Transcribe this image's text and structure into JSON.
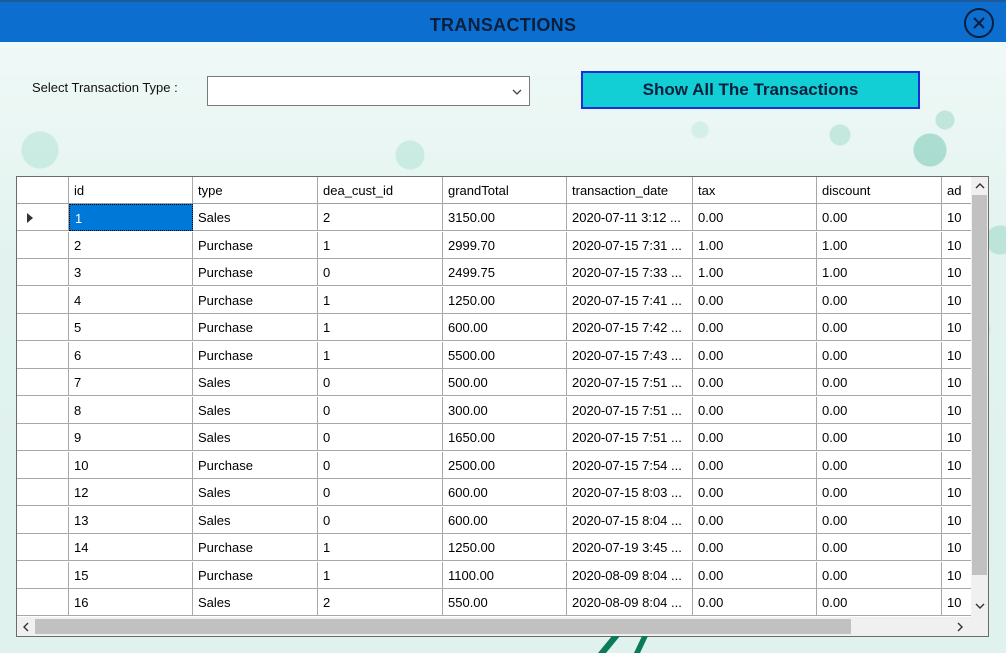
{
  "window": {
    "title": "TRANSACTIONS"
  },
  "filter": {
    "label": "Select Transaction Type :",
    "selected_value": "",
    "show_all_label": "Show All The Transactions"
  },
  "grid": {
    "columns": [
      "id",
      "type",
      "dea_cust_id",
      "grandTotal",
      "transaction_date",
      "tax",
      "discount",
      "ad"
    ],
    "rows": [
      {
        "id": "1",
        "type": "Sales",
        "dea_cust_id": "2",
        "grandTotal": "3150.00",
        "transaction_date": "2020-07-11 3:12 ...",
        "tax": "0.00",
        "discount": "0.00",
        "ad": "10"
      },
      {
        "id": "2",
        "type": "Purchase",
        "dea_cust_id": "1",
        "grandTotal": "2999.70",
        "transaction_date": "2020-07-15 7:31 ...",
        "tax": "1.00",
        "discount": "1.00",
        "ad": "10"
      },
      {
        "id": "3",
        "type": "Purchase",
        "dea_cust_id": "0",
        "grandTotal": "2499.75",
        "transaction_date": "2020-07-15 7:33 ...",
        "tax": "1.00",
        "discount": "1.00",
        "ad": "10"
      },
      {
        "id": "4",
        "type": "Purchase",
        "dea_cust_id": "1",
        "grandTotal": "1250.00",
        "transaction_date": "2020-07-15 7:41 ...",
        "tax": "0.00",
        "discount": "0.00",
        "ad": "10"
      },
      {
        "id": "5",
        "type": "Purchase",
        "dea_cust_id": "1",
        "grandTotal": "600.00",
        "transaction_date": "2020-07-15 7:42 ...",
        "tax": "0.00",
        "discount": "0.00",
        "ad": "10"
      },
      {
        "id": "6",
        "type": "Purchase",
        "dea_cust_id": "1",
        "grandTotal": "5500.00",
        "transaction_date": "2020-07-15 7:43 ...",
        "tax": "0.00",
        "discount": "0.00",
        "ad": "10"
      },
      {
        "id": "7",
        "type": "Sales",
        "dea_cust_id": "0",
        "grandTotal": "500.00",
        "transaction_date": "2020-07-15 7:51 ...",
        "tax": "0.00",
        "discount": "0.00",
        "ad": "10"
      },
      {
        "id": "8",
        "type": "Sales",
        "dea_cust_id": "0",
        "grandTotal": "300.00",
        "transaction_date": "2020-07-15 7:51 ...",
        "tax": "0.00",
        "discount": "0.00",
        "ad": "10"
      },
      {
        "id": "9",
        "type": "Sales",
        "dea_cust_id": "0",
        "grandTotal": "1650.00",
        "transaction_date": "2020-07-15 7:51 ...",
        "tax": "0.00",
        "discount": "0.00",
        "ad": "10"
      },
      {
        "id": "10",
        "type": "Purchase",
        "dea_cust_id": "0",
        "grandTotal": "2500.00",
        "transaction_date": "2020-07-15 7:54 ...",
        "tax": "0.00",
        "discount": "0.00",
        "ad": "10"
      },
      {
        "id": "12",
        "type": "Sales",
        "dea_cust_id": "0",
        "grandTotal": "600.00",
        "transaction_date": "2020-07-15 8:03 ...",
        "tax": "0.00",
        "discount": "0.00",
        "ad": "10"
      },
      {
        "id": "13",
        "type": "Sales",
        "dea_cust_id": "0",
        "grandTotal": "600.00",
        "transaction_date": "2020-07-15 8:04 ...",
        "tax": "0.00",
        "discount": "0.00",
        "ad": "10"
      },
      {
        "id": "14",
        "type": "Purchase",
        "dea_cust_id": "1",
        "grandTotal": "1250.00",
        "transaction_date": "2020-07-19 3:45 ...",
        "tax": "0.00",
        "discount": "0.00",
        "ad": "10"
      },
      {
        "id": "15",
        "type": "Purchase",
        "dea_cust_id": "1",
        "grandTotal": "1100.00",
        "transaction_date": "2020-08-09 8:04 ...",
        "tax": "0.00",
        "discount": "0.00",
        "ad": "10"
      },
      {
        "id": "16",
        "type": "Sales",
        "dea_cust_id": "2",
        "grandTotal": "550.00",
        "transaction_date": "2020-08-09 8:04 ...",
        "tax": "0.00",
        "discount": "0.00",
        "ad": "10"
      }
    ],
    "selected_row": 0
  },
  "colors": {
    "titlebar": "#0c6fcf",
    "button": "#12cfd6",
    "button_border": "#1a2fd8",
    "selection": "#0078d7"
  },
  "icons": {
    "close": "close-circle-icon",
    "dropdown": "chevron-down-icon",
    "row_indicator": "row-pointer-icon"
  }
}
